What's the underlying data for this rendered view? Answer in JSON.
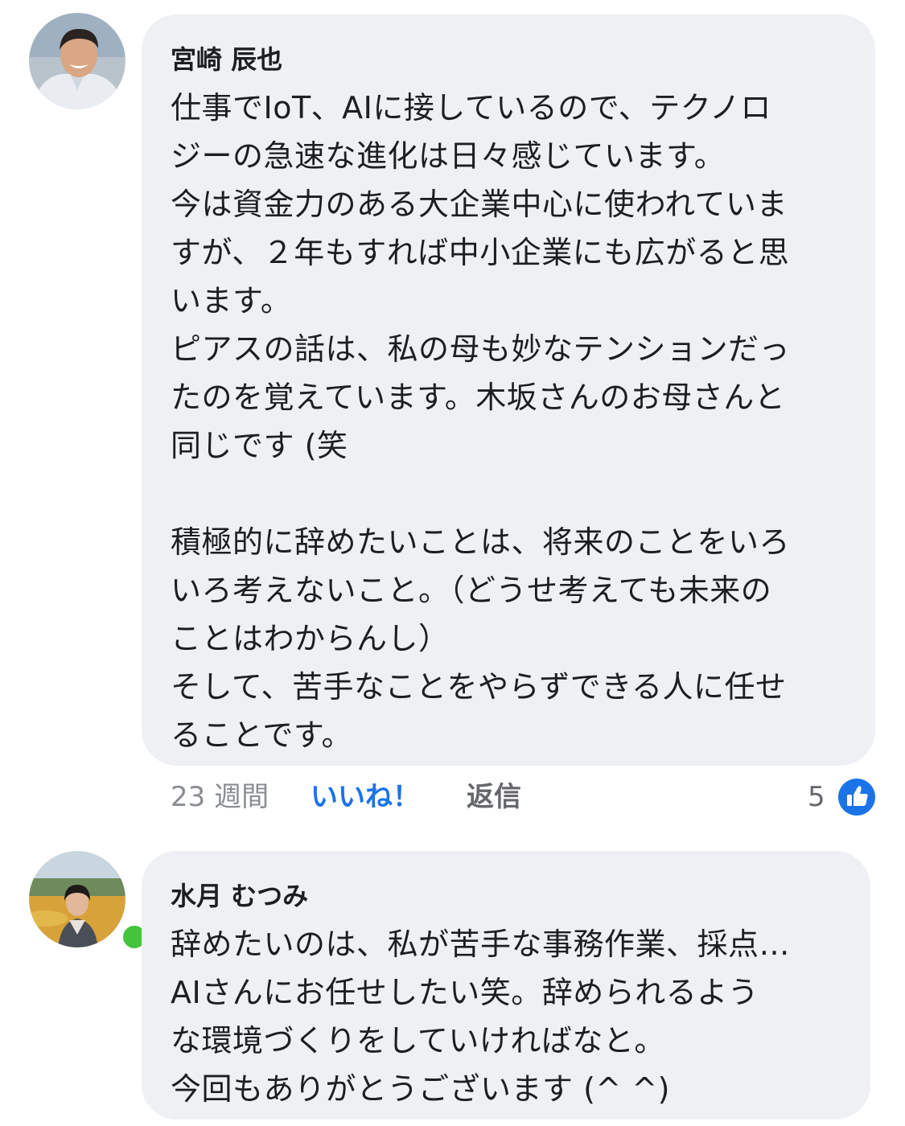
{
  "comments": [
    {
      "author": "宮崎 辰也",
      "lines": [
        "仕事でIoT、AIに接しているので、テクノロ",
        "ジーの急速な進化は日々感じています。",
        "今は資金力のある大企業中心に使われていま",
        "すが、２年もすれば中小企業にも広がると思",
        "います。",
        "ピアスの話は、私の母も妙なテンションだっ",
        "たのを覚えています。木坂さんのお母さんと",
        "同じです (笑",
        "",
        "積極的に辞めたいことは、将来のことをいろ",
        "いろ考えないこと。（どうせ考えても未来の",
        "ことはわからんし）",
        "そして、苦手なことをやらずできる人に任せ",
        "ることです。"
      ],
      "time": "23 週間",
      "like_label": "いいね！",
      "reply_label": "返信",
      "reaction_count": "5",
      "reaction_icon": "thumbs-up-icon"
    },
    {
      "author": "水月 むつみ",
      "online": true,
      "lines": [
        "辞めたいのは、私が苦手な事務作業、採点…",
        "AIさんにお任せしたい笑。辞められるよう",
        "な環境づくりをしていければなと。",
        "今回もありがとうございます (^ ^)"
      ]
    }
  ],
  "colors": {
    "bubble": "#eff0f4",
    "link_blue": "#1a74e8",
    "meta_gray": "#8a8d91",
    "online_green": "#44c43c"
  }
}
